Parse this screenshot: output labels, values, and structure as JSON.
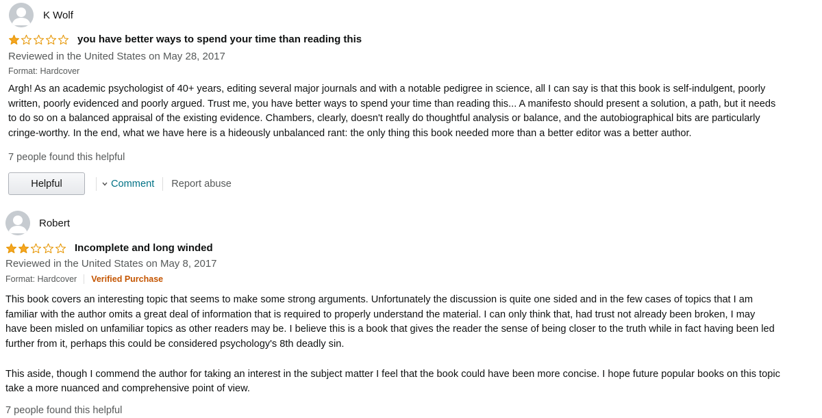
{
  "reviews": [
    {
      "reviewer": "K Wolf",
      "rating": 1,
      "title": "you have better ways to spend your time than reading this",
      "date_line": "Reviewed in the United States on May 28, 2017",
      "format": "Format: Hardcover",
      "body_lines": [
        "Argh! As an academic psychologist of 40+ years, editing several major journals and with a notable pedigree in science, all I can say is that this book is self-indulgent, poorly",
        "written, poorly evidenced and poorly argued. Trust me, you have better ways to spend your time than reading this... A manifesto should present a solution, a path, but it needs",
        "to do so on a balanced appraisal of the existing evidence. Chambers, clearly, doesn't really do thoughtful analysis or balance, and the autobiographical bits are particularly",
        "cringe-worthy. In the end, what we have here is a hideously unbalanced rant: the only thing this book needed more than a better editor was a better author."
      ],
      "helpful_count": "7 people found this helpful",
      "helpful_button": "Helpful",
      "comment_label": "Comment",
      "report_label": "Report abuse"
    },
    {
      "reviewer": "Robert",
      "rating": 2,
      "title": "Incomplete and long winded",
      "date_line": "Reviewed in the United States on May 8, 2017",
      "format": "Format: Hardcover",
      "verified": "Verified Purchase",
      "body_lines": [
        "This book covers an interesting topic that seems to make some strong arguments. Unfortunately the discussion is quite one sided and in the few cases of topics that I am",
        "familiar with the author omits a great deal of information that is required to properly understand the material. I can only think that, had trust not already been broken, I may",
        "have been misled on unfamiliar topics as other readers may be. I believe this is a book that gives the reader the sense of being closer to the truth while in fact having been led",
        "further from it, perhaps this could be considered psychology's 8th deadly sin.",
        "This aside, though I commend the author for taking an interest in the subject matter I feel that the book could have been more concise. I hope future popular books on this topic",
        "take a more nuanced and comprehensive point of view."
      ],
      "helpful_count": "7 people found this helpful"
    }
  ],
  "colors": {
    "star_filled": "#f5a623",
    "star_empty_stroke": "#e69500",
    "link": "#007185",
    "verified": "#c45500",
    "muted": "#565959"
  },
  "icons": {
    "avatar": "default-user-avatar-icon",
    "star": "star-icon",
    "comment_caret": "chevron-down-icon"
  }
}
